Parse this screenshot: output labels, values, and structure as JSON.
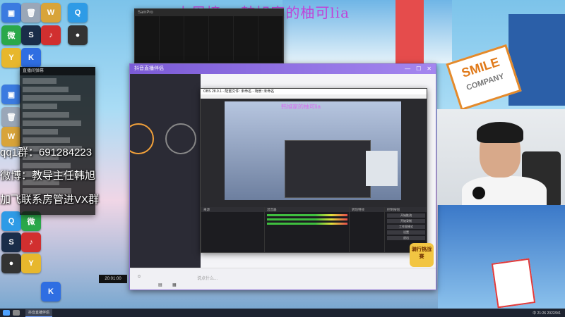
{
  "overlay": {
    "top_title": "上周榜 ：韩旭家的柚可lia",
    "qq_line": "qq1群：691284223",
    "weibo_line": "微博：教导主任韩旭",
    "vx_line": "加飞联系房管进VX群"
  },
  "desktop_icons": [
    {
      "label": "此电脑",
      "color": "#3b7be0",
      "glyph": "▣"
    },
    {
      "label": "回收站",
      "color": "#9aa7b8",
      "glyph": "🗑"
    },
    {
      "label": "WeGame",
      "color": "#d8a43a",
      "glyph": "W"
    },
    {
      "label": "QQ",
      "color": "#2e9be6",
      "glyph": "Q"
    },
    {
      "label": "微信",
      "color": "#2aa84a",
      "glyph": "微"
    },
    {
      "label": "Steam",
      "color": "#1a2d49",
      "glyph": "S"
    },
    {
      "label": "网易云",
      "color": "#d12f2f",
      "glyph": "♪"
    },
    {
      "label": "OBS",
      "color": "#333",
      "glyph": "●"
    },
    {
      "label": "YY",
      "color": "#e7b72d",
      "glyph": "Y"
    },
    {
      "label": "K",
      "color": "#2f6ee2",
      "glyph": "K"
    }
  ],
  "windows": {
    "trade": {
      "title": "SamPro"
    },
    "chat": {
      "header": "直播间弹幕"
    },
    "live": {
      "title": "抖音直播伴侣",
      "input_placeholder": "说点什么..."
    },
    "obs": {
      "title": "OBS 28.0.1 - 配置文件: 未命名 - 场景: 未命名",
      "preview_text": "韩旭家的柚可lia",
      "docks": [
        "来源",
        "混音器",
        "转场特效",
        "控制按钮"
      ],
      "controls": [
        "开始推流",
        "开始录制",
        "工作室模式",
        "设置",
        "退出"
      ]
    }
  },
  "badges": {
    "rider": "骑行挑战赛",
    "clock": "20:01:00"
  },
  "taskbar": {
    "app_label": "抖音直播伴侣",
    "tray_text": "中 21:26 2022/9/1"
  }
}
